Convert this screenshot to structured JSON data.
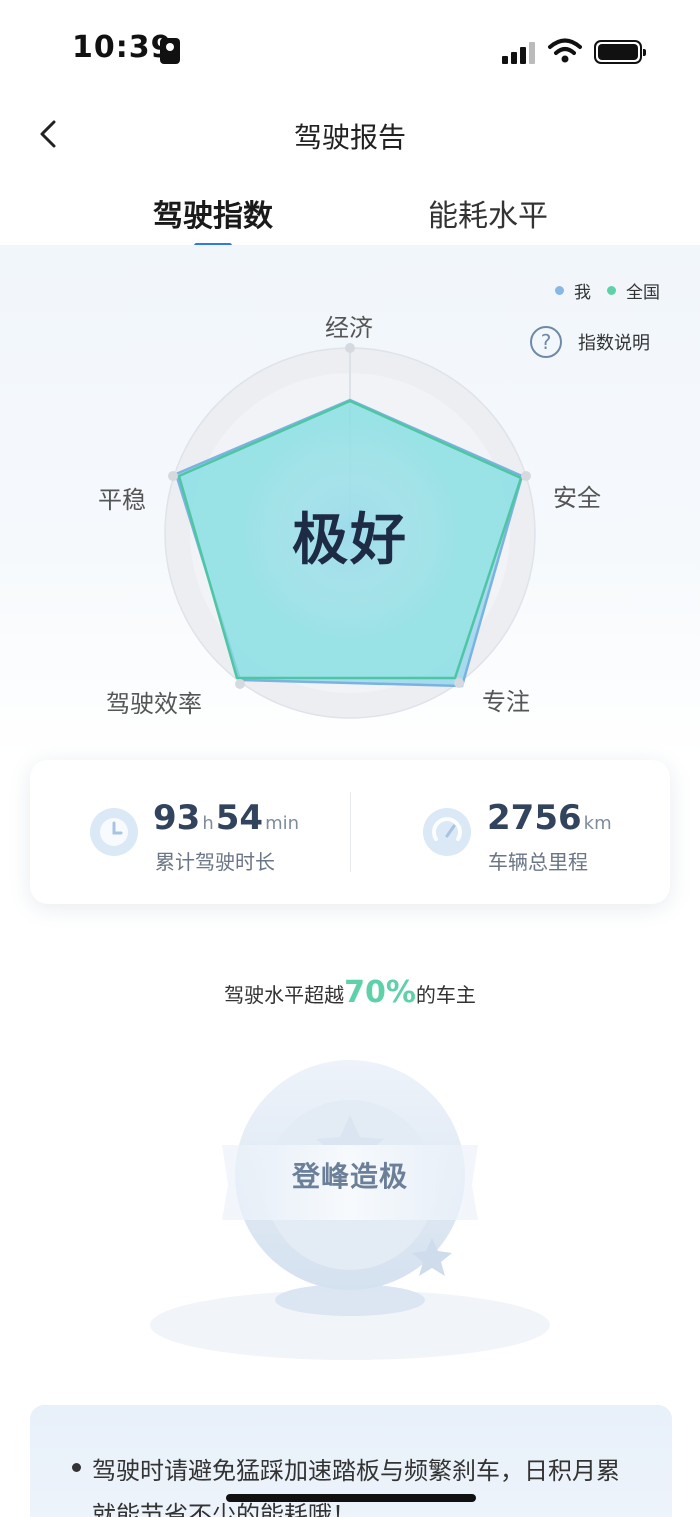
{
  "status_bar": {
    "time": "10:39"
  },
  "nav": {
    "title": "驾驶报告",
    "back_icon": "chevron-left-icon"
  },
  "tabs": [
    {
      "label": "驾驶指数",
      "active": true
    },
    {
      "label": "能耗水平",
      "active": false
    }
  ],
  "legend": [
    {
      "label": "我",
      "color": "#86b7e6"
    },
    {
      "label": "全国",
      "color": "#5fd1a8"
    }
  ],
  "help": {
    "label": "指数说明",
    "icon": "question-circle-icon"
  },
  "radar": {
    "axes": [
      "经济",
      "安全",
      "专注",
      "驾驶效率",
      "平稳"
    ],
    "grade": "极好"
  },
  "stats": {
    "driving_time": {
      "hours": "93",
      "hours_unit": "h",
      "minutes": "54",
      "minutes_unit": "min",
      "label": "累计驾驶时长",
      "icon": "clock-icon"
    },
    "mileage": {
      "value": "2756",
      "unit": "km",
      "label": "车辆总里程",
      "icon": "speedometer-icon"
    }
  },
  "rank": {
    "prefix": "驾驶水平超越",
    "percent": "70%",
    "suffix": "的车主"
  },
  "badge": {
    "title": "登峰造极"
  },
  "tip": {
    "text": "驾驶时请避免猛踩加速踏板与频繁刹车，日积月累就能节省不少的能耗哦！"
  }
}
